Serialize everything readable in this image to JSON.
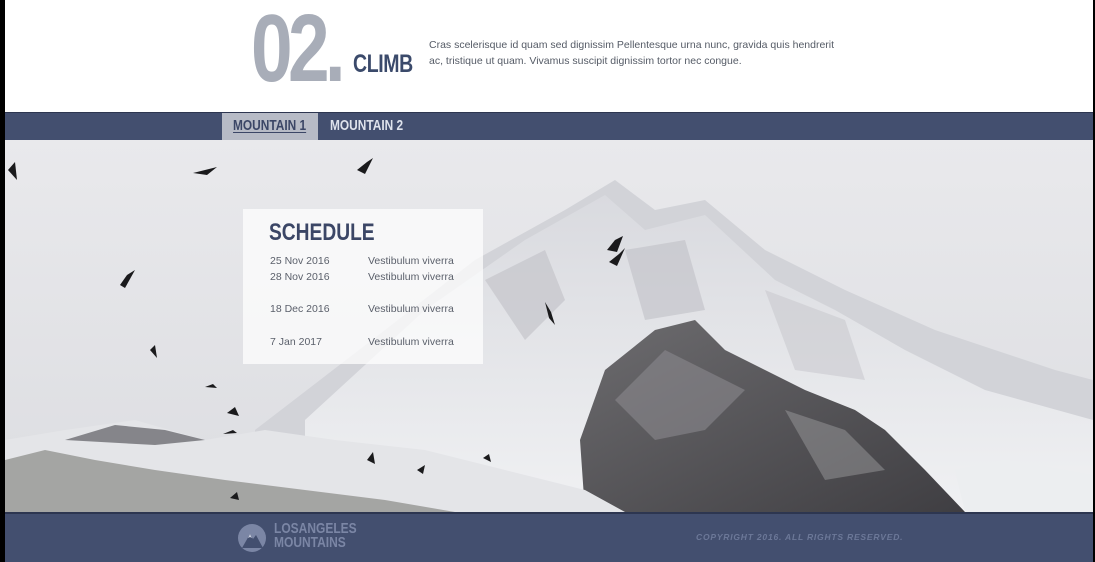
{
  "intro": {
    "number": "02.",
    "title": "CLIMB",
    "text": "Cras scelerisque id quam sed dignissim Pellentesque urna nunc, gravida quis hendrerit ac, tristique ut quam. Vivamus suscipit dignissim tortor nec congue."
  },
  "tabs": [
    {
      "label": "MOUNTAIN 1",
      "active": true
    },
    {
      "label": "MOUNTAIN 2",
      "active": false
    }
  ],
  "schedule": {
    "title": "SCHEDULE",
    "rows": [
      {
        "date": "25 Nov 2016",
        "event": "Vestibulum viverra"
      },
      {
        "date": "28 Nov 2016",
        "event": "Vestibulum viverra"
      },
      {
        "date": "18 Dec 2016",
        "event": "Vestibulum viverra"
      },
      {
        "date": "7 Jan 2017",
        "event": "Vestibulum viverra"
      }
    ]
  },
  "footer": {
    "logo_line1": "LOSANGELES",
    "logo_line2": "MOUNTAINS",
    "copyright": "COPYRIGHT 2016. ALL RIGHTS RESERVED."
  },
  "colors": {
    "nav_bg": "#434f6f",
    "tab_active_bg": "#b7bbc6",
    "heading": "#3b4666",
    "number_grey": "#a8adb8"
  },
  "icons": {
    "logo": "mountain-logo-icon"
  }
}
